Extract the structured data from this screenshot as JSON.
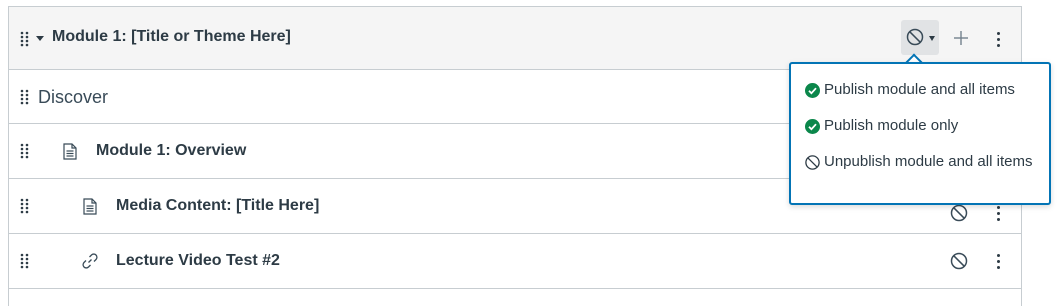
{
  "module": {
    "title": "Module 1: [Title or Theme Here]",
    "publish_state": "unpublished",
    "publish_button_icon": "ban-icon",
    "add_icon": "plus-icon",
    "menu_icon": "kebab-icon"
  },
  "items": [
    {
      "type": "subheader",
      "title": "Discover"
    },
    {
      "type": "page",
      "title": "Module 1: Overview",
      "icon": "page-icon",
      "indent": 1
    },
    {
      "type": "page",
      "title": "Media Content: [Title Here]",
      "icon": "page-icon",
      "indent": 2,
      "publish_icon": "ban-icon"
    },
    {
      "type": "link",
      "title": "Lecture Video Test #2",
      "icon": "link-icon",
      "indent": 2,
      "publish_icon": "ban-icon"
    }
  ],
  "publish_menu": {
    "options": [
      {
        "label": "Publish module and all items",
        "icon": "check-circle-icon"
      },
      {
        "label": "Publish module only",
        "icon": "check-circle-icon"
      },
      {
        "label": "Unpublish module and all items",
        "icon": "ban-icon"
      }
    ]
  },
  "colors": {
    "success": "#0b874b",
    "focus_border": "#0374b5",
    "header_bg": "#f5f5f5",
    "border": "#c7cdd1",
    "text": "#2d3b45"
  }
}
